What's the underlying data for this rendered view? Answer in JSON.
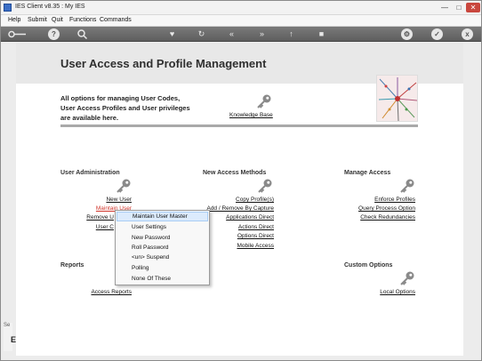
{
  "window": {
    "title": "IES Client v8.35 : My IES"
  },
  "menubar": {
    "items": [
      "Help",
      "Submit",
      "Quit",
      "Functions",
      "Commands"
    ]
  },
  "toolbar": {
    "buttons": [
      "key-icon",
      "help-icon",
      "search-icon",
      "heart-icon",
      "refresh-icon",
      "rewind-icon",
      "fast-forward-icon",
      "upload-icon",
      "stop-icon",
      "gear-icon",
      "check-icon",
      "close-icon"
    ],
    "help_glyph": "?",
    "close_glyph": "x"
  },
  "page": {
    "title": "User Access and Profile Management",
    "intro_lines": [
      "All options for managing User Codes,",
      "User Access Profiles and User privileges",
      "are available here."
    ],
    "knowledge_base": "Knowledge Base"
  },
  "sections": {
    "user_admin": {
      "heading": "User Administration",
      "links": [
        "New User",
        "Maintain User",
        "Remove U",
        "User C"
      ]
    },
    "new_access": {
      "heading": "New Access Methods",
      "links": [
        "Copy Profile(s)",
        "Add / Remove By Capture",
        "Applications Direct",
        "Actions Direct",
        "Options Direct",
        "Mobile Access"
      ]
    },
    "manage_access": {
      "heading": "Manage Access",
      "links": [
        "Enforce Profiles",
        "Query Process Option",
        "Check Redundancies"
      ]
    },
    "reports": {
      "heading": "Reports",
      "links": [
        "Access Reports"
      ]
    },
    "custom_options": {
      "heading": "Custom Options",
      "links": [
        "Local Options"
      ]
    }
  },
  "context_menu": {
    "items": [
      "Maintain User Master",
      "User Settings",
      "New Password",
      "Roll Password",
      "<un> Suspend",
      "Polling",
      "None Of These"
    ]
  },
  "left_edge": {
    "mark": "Se",
    "letter": "E"
  },
  "colors": {
    "toolbar": "#6b6b6b",
    "accent_link": "#d0362c",
    "highlight": "#dcebfc"
  }
}
